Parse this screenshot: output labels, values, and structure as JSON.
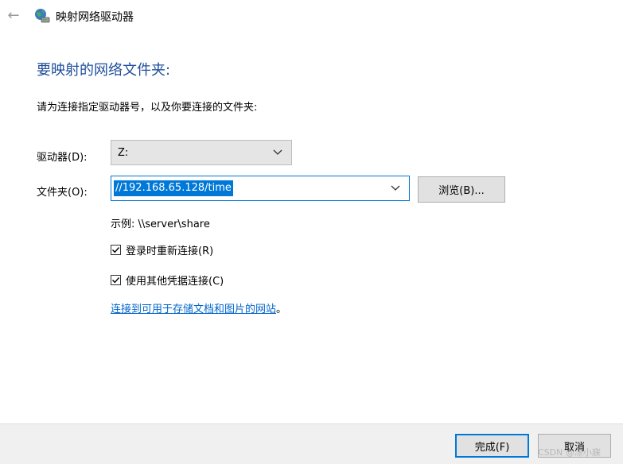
{
  "window": {
    "title": "映射网络驱动器",
    "back_icon": "back-arrow-icon",
    "app_icon": "network-drive-icon"
  },
  "main": {
    "heading": "要映射的网络文件夹:",
    "instruction": "请为连接指定驱动器号，以及你要连接的文件夹:",
    "drive": {
      "label": "驱动器(D):",
      "value": "Z:"
    },
    "folder": {
      "label": "文件夹(O):",
      "value": "//192.168.65.128/time",
      "browse_label": "浏览(B)..."
    },
    "example": "示例: \\\\server\\share",
    "options": [
      {
        "label": "登录时重新连接(R)",
        "checked": true
      },
      {
        "label": "使用其他凭据连接(C)",
        "checked": true
      }
    ],
    "link_text": "连接到可用于存储文档和图片的网站",
    "link_suffix": "。"
  },
  "footer": {
    "finish_label": "完成(F)",
    "cancel_label": "取消"
  },
  "watermark": "CSDN @冻小寐",
  "colors": {
    "heading": "#1f4e9c",
    "accent": "#0078d7",
    "link": "#0066cc"
  }
}
